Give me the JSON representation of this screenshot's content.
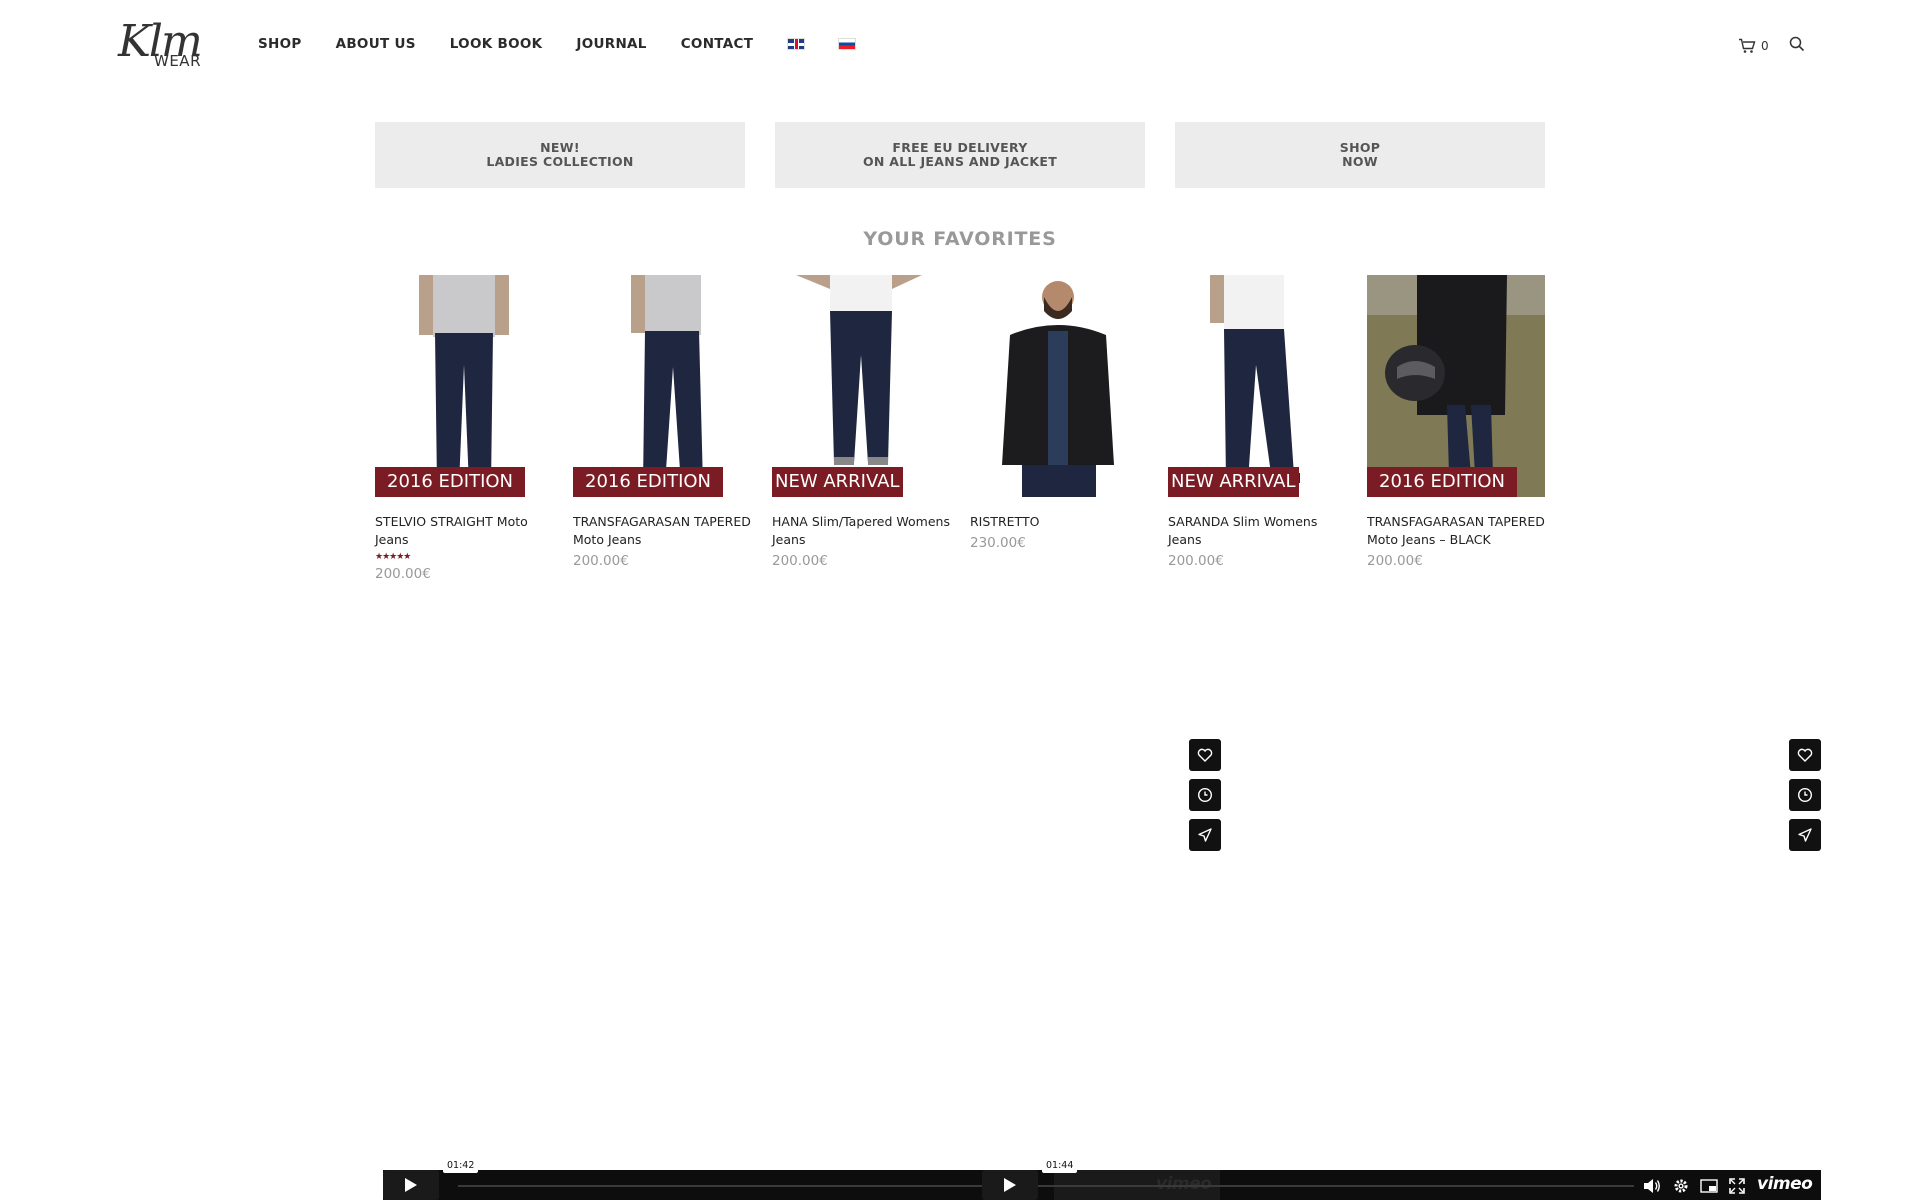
{
  "brand": {
    "logo_script": "Klm",
    "logo_sub": "WEAR"
  },
  "nav": {
    "items": [
      "SHOP",
      "ABOUT US",
      "LOOK BOOK",
      "JOURNAL",
      "CONTACT"
    ],
    "flags": [
      "english-flag-icon",
      "slovak-flag-icon"
    ]
  },
  "header": {
    "cart_count": "0"
  },
  "banners": [
    {
      "line1": "NEW!",
      "line2": "LADIES COLLECTION"
    },
    {
      "line1": "FREE EU DELIVERY",
      "line2": "ON ALL JEANS AND JACKET"
    },
    {
      "line1": "SHOP",
      "line2": "NOW"
    }
  ],
  "section_title": "YOUR FAVORITES",
  "products": [
    {
      "badge": "2016 EDITION",
      "name": "STELVIO STRAIGHT Moto Jeans",
      "rating": "★★★★★",
      "price": "200.00€"
    },
    {
      "badge": "2016 EDITION",
      "name": "TRANSFAGARASAN TAPERED Moto Jeans",
      "price": "200.00€"
    },
    {
      "badge": "NEW ARRIVAL",
      "name": "HANA Slim/Tapered Womens Jeans",
      "price": "200.00€"
    },
    {
      "badge": "",
      "name": "RISTRETTO",
      "price": "230.00€"
    },
    {
      "badge": "NEW ARRIVAL",
      "name": "SARANDA Slim Womens Jeans",
      "price": "200.00€"
    },
    {
      "badge": "2016 EDITION",
      "name": "TRANSFAGARASAN TAPERED Moto Jeans – BLACK",
      "price": "200.00€"
    }
  ],
  "video": {
    "time_1": "01:42",
    "time_2": "01:44",
    "brand": "vimeo"
  },
  "colors": {
    "badge": "#7b1b24",
    "banner_bg": "#ececec",
    "muted": "#999999"
  }
}
